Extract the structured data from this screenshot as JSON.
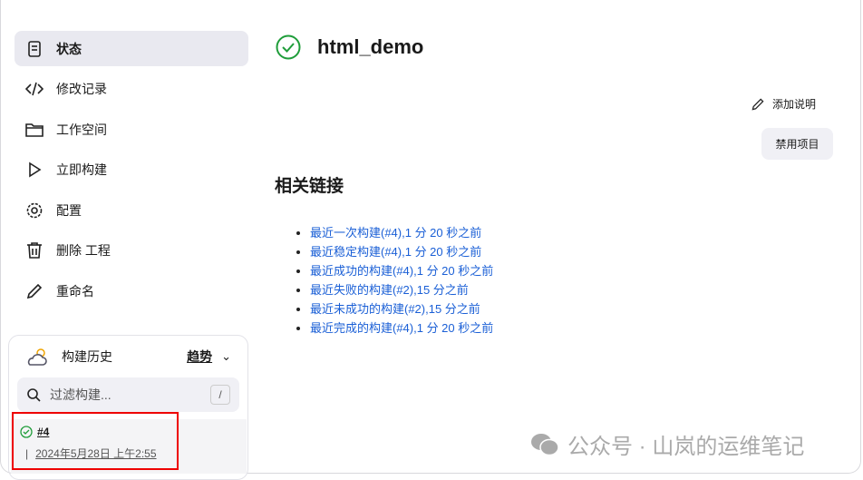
{
  "sidebar": {
    "items": [
      {
        "label": "状态",
        "icon": "status-icon"
      },
      {
        "label": "修改记录",
        "icon": "code-icon"
      },
      {
        "label": "工作空间",
        "icon": "folder-icon"
      },
      {
        "label": "立即构建",
        "icon": "play-icon"
      },
      {
        "label": "配置",
        "icon": "gear-icon"
      },
      {
        "label": "删除 工程",
        "icon": "trash-icon"
      },
      {
        "label": "重命名",
        "icon": "pencil-icon"
      }
    ]
  },
  "history": {
    "title": "构建历史",
    "trend": "趋势",
    "search_placeholder": "过滤构建...",
    "shortcut": "/",
    "builds": [
      {
        "number": "#4",
        "date": "2024年5月28日 上午2:55",
        "status": "success"
      }
    ]
  },
  "project": {
    "name": "html_demo",
    "status": "success"
  },
  "actions": {
    "add_description": "添加说明",
    "disable": "禁用项目"
  },
  "related": {
    "title": "相关链接",
    "links": [
      "最近一次构建(#4),1 分 20 秒之前",
      "最近稳定构建(#4),1 分 20 秒之前",
      "最近成功的构建(#4),1 分 20 秒之前",
      "最近失败的构建(#2),15 分之前",
      "最近未成功的构建(#2),15 分之前",
      "最近完成的构建(#4),1 分 20 秒之前"
    ]
  },
  "watermark": "公众号 · 山岚的运维笔记",
  "colors": {
    "link": "#1a5fd6",
    "success": "#1f9d3a",
    "highlight": "#e00000"
  }
}
